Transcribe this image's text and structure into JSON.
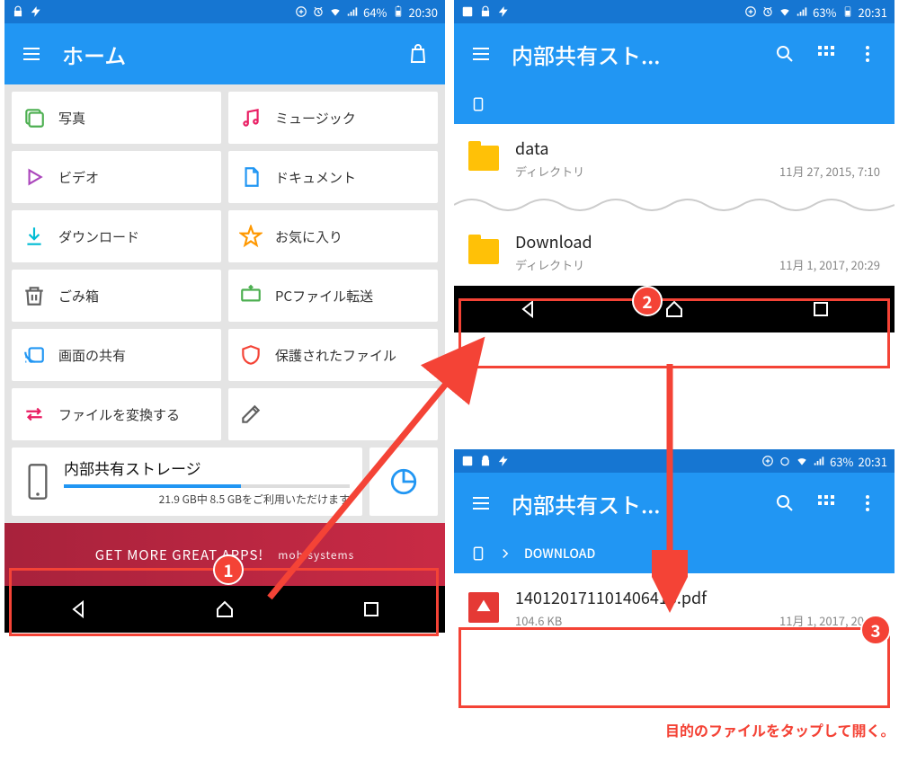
{
  "left": {
    "status": {
      "battery_pct": "64%",
      "time": "20:30"
    },
    "appbar": {
      "title": "ホーム"
    },
    "tiles": [
      {
        "label": "写真"
      },
      {
        "label": "ミュージック"
      },
      {
        "label": "ビデオ"
      },
      {
        "label": "ドキュメント"
      },
      {
        "label": "ダウンロード"
      },
      {
        "label": "お気に入り"
      },
      {
        "label": "ごみ箱"
      },
      {
        "label": "PCファイル転送"
      },
      {
        "label": "画面の共有"
      },
      {
        "label": "保護されたファイル"
      },
      {
        "label": "ファイルを変換する"
      },
      {
        "label": ""
      }
    ],
    "storage": {
      "title": "内部共有ストレージ",
      "detail": "21.9 GB中 8.5 GBをご利用いただけます"
    },
    "banner": {
      "text": "GET MORE GREAT APPS!",
      "brand": "mobisystems"
    }
  },
  "top_right": {
    "status": {
      "battery_pct": "63%",
      "time": "20:31"
    },
    "appbar": {
      "title": "内部共有スト..."
    },
    "rows": [
      {
        "title": "data",
        "sub": "ディレクトリ",
        "date": "11月 27, 2015, 7:10"
      },
      {
        "title": "Download",
        "sub": "ディレクトリ",
        "date": "11月 1, 2017, 20:29"
      }
    ]
  },
  "bottom_right": {
    "status": {
      "battery_pct": "63%",
      "time": "20:31"
    },
    "appbar": {
      "title": "内部共有スト..."
    },
    "breadcrumb": {
      "label": "DOWNLOAD"
    },
    "rows": [
      {
        "title": "140120171101406413.pdf",
        "size": "104.6 KB",
        "date": "11月 1, 2017, 20:26"
      }
    ]
  },
  "badges": {
    "b1": "1",
    "b2": "2",
    "b3": "3"
  },
  "caption": "目的のファイルをタップして開く。"
}
